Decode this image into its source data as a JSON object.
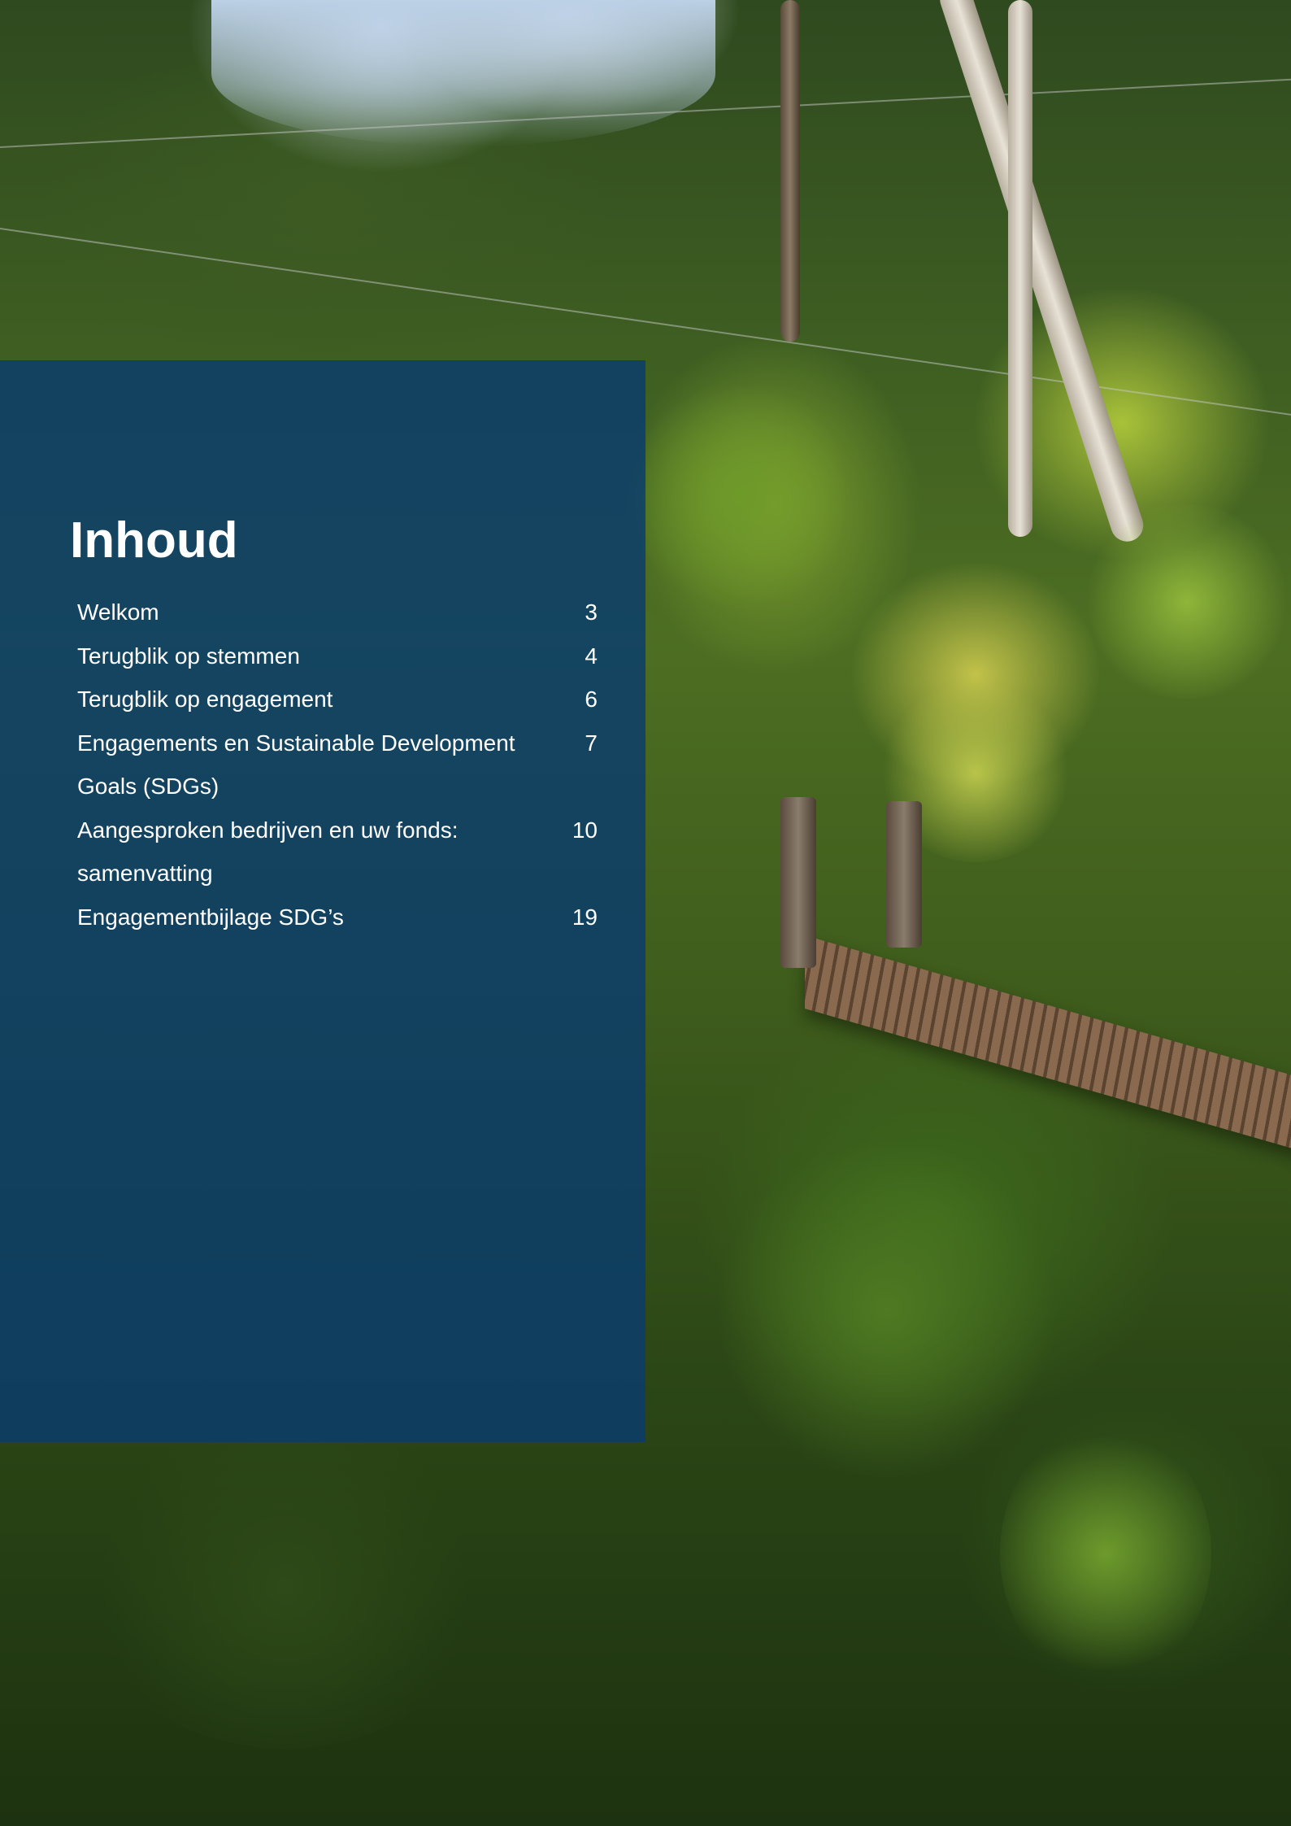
{
  "toc": {
    "title": "Inhoud",
    "entries": [
      {
        "label": "Welkom",
        "page": "3"
      },
      {
        "label": "Terugblik op stemmen",
        "page": "4"
      },
      {
        "label": "Terugblik op engagement",
        "page": "6"
      },
      {
        "label": "Engagements en Sustainable Development Goals (SDGs)",
        "page": "7"
      },
      {
        "label": "Aangesproken bedrijven en uw fonds: samenvatting",
        "page": "10"
      },
      {
        "label": "Engagementbijlage SDG’s",
        "page": "19"
      }
    ]
  },
  "colors": {
    "panel": "#083c6e",
    "text": "#ffffff"
  }
}
